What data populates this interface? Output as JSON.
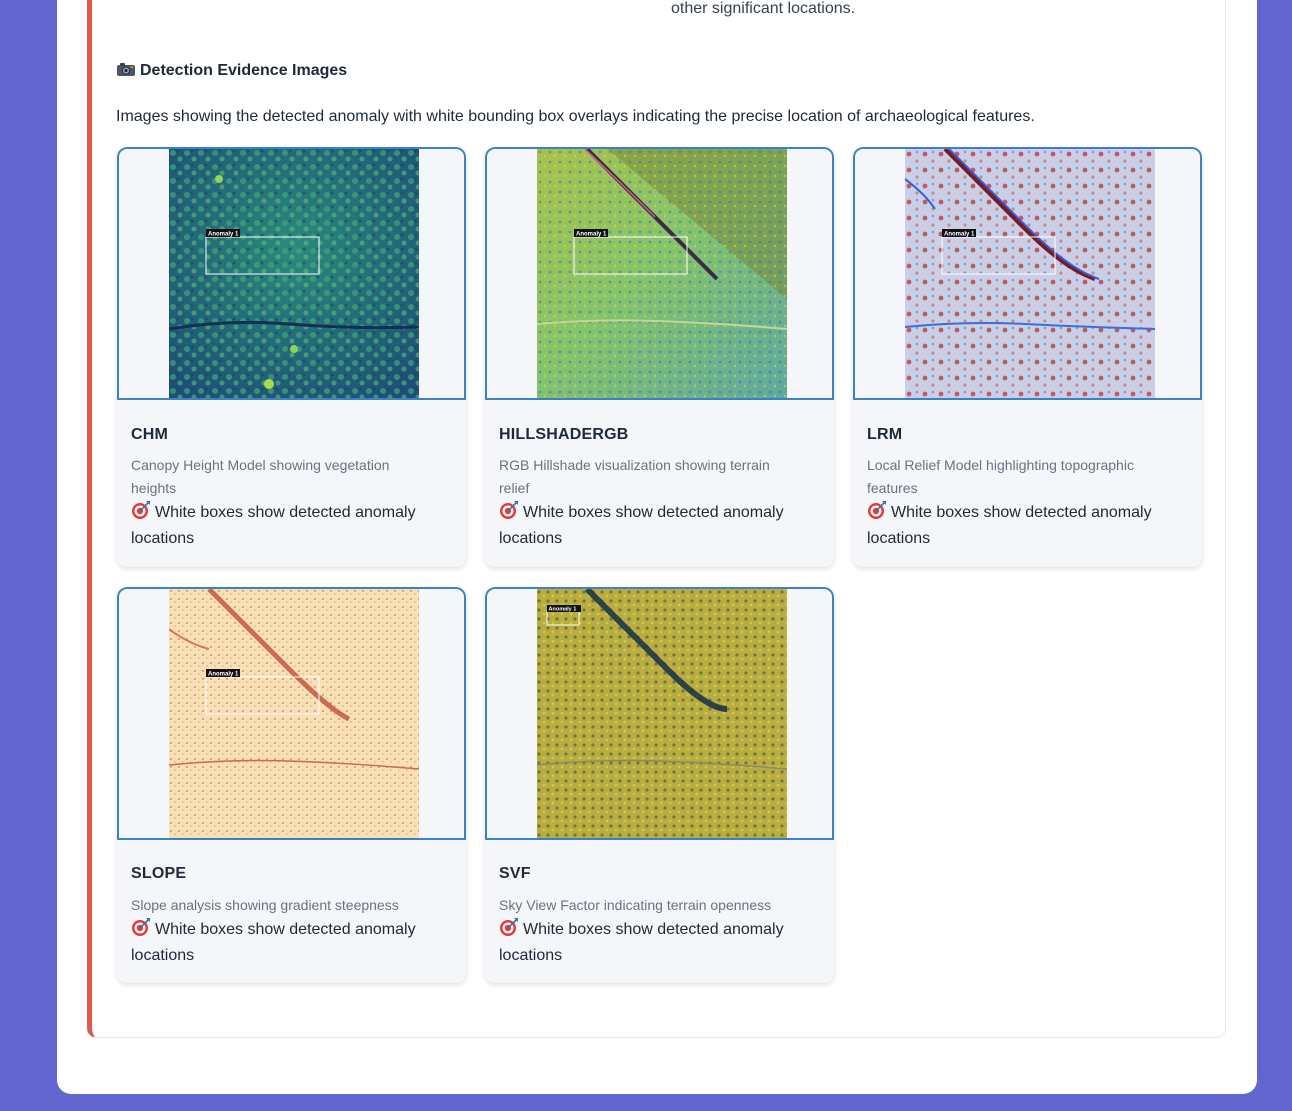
{
  "previous_section": {
    "trailing_text": "other significant locations."
  },
  "section": {
    "icon": "camera-icon",
    "title": "Detection Evidence Images",
    "description": "Images showing the detected anomaly with white bounding box overlays indicating the precise location of archaeological features."
  },
  "cards": [
    {
      "title": "CHM",
      "description": "Canopy Height Model showing vegetation heights",
      "note": "White boxes show detected anomaly locations",
      "box_label": "Anomaly 1"
    },
    {
      "title": "HILLSHADERGB",
      "description": "RGB Hillshade visualization showing terrain relief",
      "note": "White boxes show detected anomaly locations",
      "box_label": "Anomaly 1"
    },
    {
      "title": "LRM",
      "description": "Local Relief Model highlighting topographic features",
      "note": "White boxes show detected anomaly locations",
      "box_label": "Anomaly 1"
    },
    {
      "title": "SLOPE",
      "description": "Slope analysis showing gradient steepness",
      "note": "White boxes show detected anomaly locations",
      "box_label": "Anomaly 1"
    },
    {
      "title": "SVF",
      "description": "Sky View Factor indicating terrain openness",
      "note": "White boxes show detected anomaly locations",
      "box_label": "Anomaly 1"
    }
  ],
  "colors": {
    "page_background": "#6466cf",
    "report_accent_border": "#e4574a",
    "image_frame_border": "#3b82c4",
    "chm_base": "#2a6e8a",
    "hillshade_base": "#8bbf6a",
    "lrm_base": "#c9cfe8",
    "slope_base": "#f7e0b5",
    "svf_base": "#b8ad3e"
  },
  "note_icon": "target-icon"
}
